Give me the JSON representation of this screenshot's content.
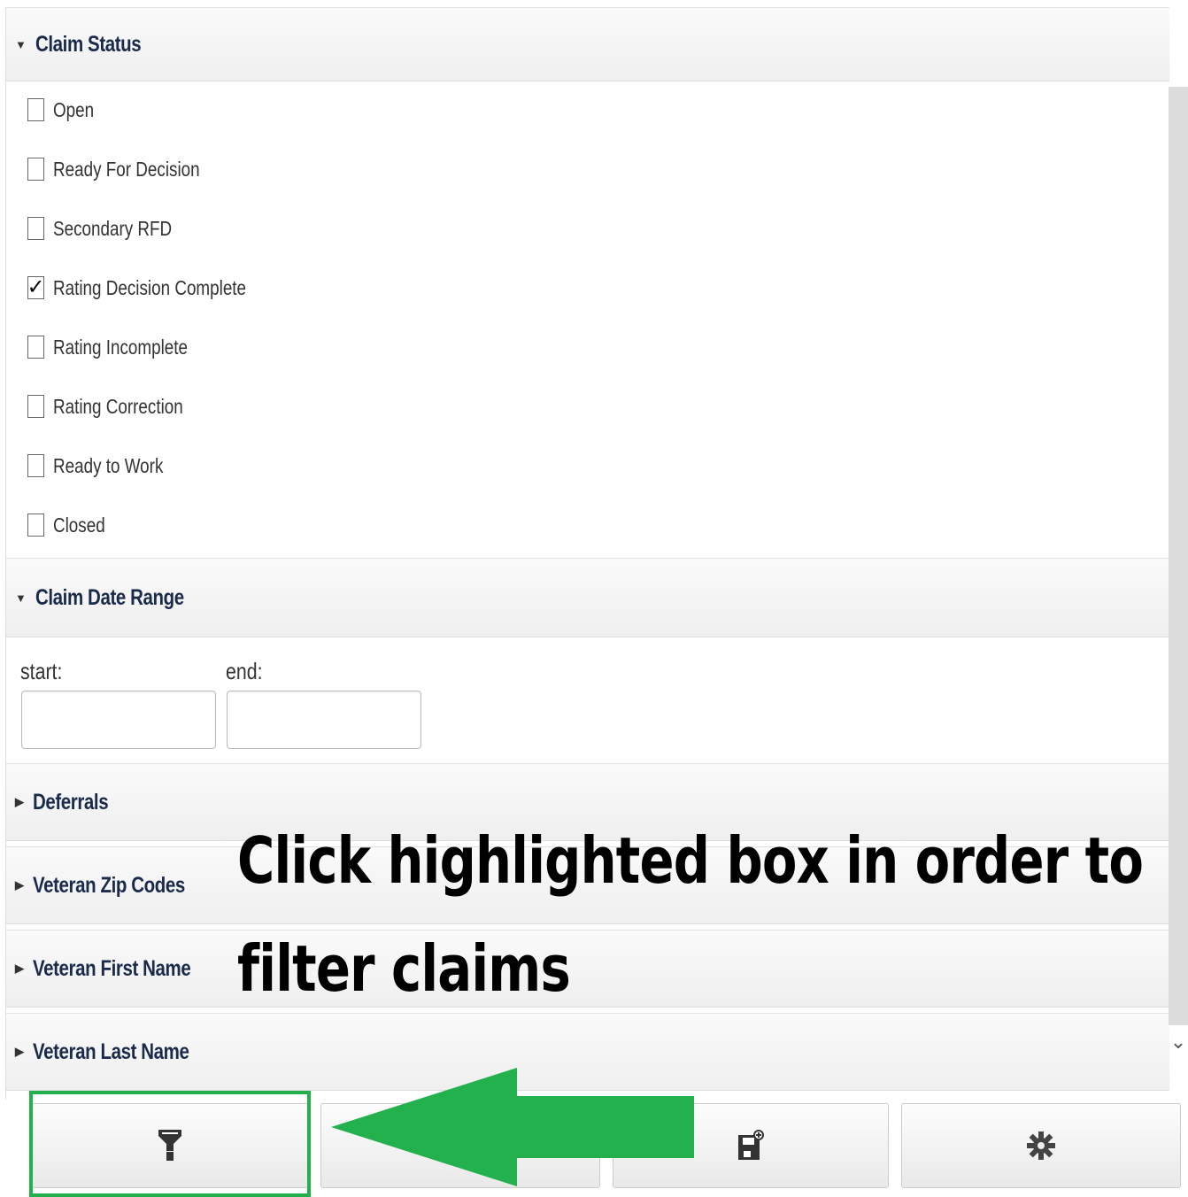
{
  "claim_status": {
    "title": "Claim Status",
    "options": [
      {
        "label": "Open",
        "checked": false
      },
      {
        "label": "Ready For Decision",
        "checked": false
      },
      {
        "label": "Secondary RFD",
        "checked": false
      },
      {
        "label": "Rating Decision Complete",
        "checked": true
      },
      {
        "label": "Rating Incomplete",
        "checked": false
      },
      {
        "label": "Rating Correction",
        "checked": false
      },
      {
        "label": "Ready to Work",
        "checked": false
      },
      {
        "label": "Closed",
        "checked": false
      }
    ]
  },
  "claim_date_range": {
    "title": "Claim Date Range",
    "start_label": "start:",
    "end_label": "end:",
    "start_value": "",
    "end_value": ""
  },
  "collapsed_sections": {
    "deferrals": "Deferrals",
    "zip_codes": "Veteran Zip Codes",
    "first_name": "Veteran First Name",
    "last_name": "Veteran Last Name"
  },
  "annotation": {
    "line1": "Click highlighted box in order to",
    "line2": "filter claims"
  },
  "toolbar": {
    "filter_icon": "filter-icon",
    "save_icon": "save-icon",
    "settings_icon": "gear-icon"
  },
  "colors": {
    "highlight": "#22b14c",
    "arrow": "#22b14c"
  }
}
